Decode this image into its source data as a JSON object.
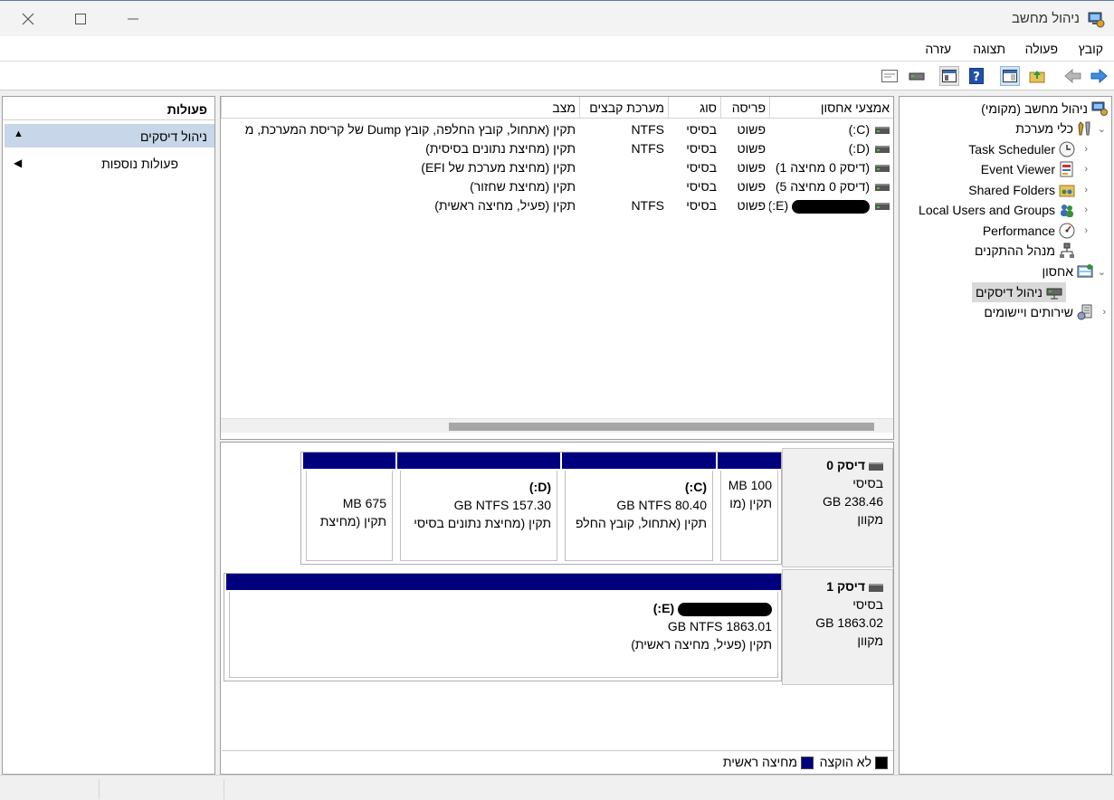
{
  "window": {
    "title": "ניהול מחשב"
  },
  "menu": [
    "קובץ",
    "פעולה",
    "תצוגה",
    "עזרה"
  ],
  "toolbar": [
    "back-arrow-icon",
    "forward-arrow-icon",
    "up-folder-icon",
    "show-hide-tree-icon",
    "help-icon",
    "properties-icon",
    "disk-icon",
    "console-icon"
  ],
  "tree": {
    "root": "ניהול מחשב (מקומי)",
    "system_tools": "כלי מערכת",
    "task_scheduler": "Task Scheduler",
    "event_viewer": "Event Viewer",
    "shared_folders": "Shared Folders",
    "local_users": "Local Users and Groups",
    "performance": "Performance",
    "device_manager": "מנהל ההתקנים",
    "storage": "אחסון",
    "disk_management": "ניהול דיסקים",
    "services": "שירותים ויישומים"
  },
  "actions": {
    "header": "פעולות",
    "section": "ניהול דיסקים",
    "more": "פעולות נוספות"
  },
  "volume_list": {
    "columns": [
      "אמצעי אחסון",
      "פריסה",
      "סוג",
      "מערכת קבצים",
      "מצב"
    ],
    "rows": [
      {
        "volume": "(C:)",
        "layout": "פשוט",
        "type": "בסיסי",
        "fs": "NTFS",
        "status": "תקין (אתחול, קובץ החלפה, קובץ Dump של קריסת המערכת, מ"
      },
      {
        "volume": "(D:)",
        "layout": "פשוט",
        "type": "בסיסי",
        "fs": "NTFS",
        "status": "תקין (מחיצת נתונים בסיסית)"
      },
      {
        "volume": "(דיסק 0 מחיצה 1)",
        "layout": "פשוט",
        "type": "בסיסי",
        "fs": "",
        "status": "תקין (מחיצת מערכת של EFI)"
      },
      {
        "volume": "(דיסק 0 מחיצה 5)",
        "layout": "פשוט",
        "type": "בסיסי",
        "fs": "",
        "status": "תקין (מחיצת שחזור)"
      },
      {
        "volume": "(E:)",
        "layout": "פשוט",
        "type": "בסיסי",
        "fs": "NTFS",
        "status": "תקין (פעיל, מחיצה ראשית)"
      }
    ]
  },
  "disks": {
    "disk0": {
      "name": "דיסק 0",
      "type": "בסיסי",
      "size": "238.46 GB",
      "state": "מקוון",
      "partitions": [
        {
          "name": "",
          "size": "100 MB",
          "status": "תקין (מו"
        },
        {
          "name": "(C:)",
          "size": "80.40 GB NTFS",
          "status": "תקין (אתחול, קובץ החלפ"
        },
        {
          "name": "(D:)",
          "size": "157.30 GB NTFS",
          "status": "תקין (מחיצת נתונים בסיסי"
        },
        {
          "name": "",
          "size": "675 MB",
          "status": "תקין (מחיצת"
        }
      ]
    },
    "disk1": {
      "name": "דיסק 1",
      "type": "בסיסי",
      "size": "1863.02 GB",
      "state": "מקוון",
      "partition": {
        "name": "(E:)",
        "size": "1863.01 GB NTFS",
        "status": "תקין (פעיל, מחיצה ראשית)"
      }
    }
  },
  "legend": {
    "unallocated": "לא הוקצה",
    "primary": "מחיצה ראשית"
  },
  "colors": {
    "primary_partition": "#00007f",
    "unallocated": "#000000",
    "selected_action": "#c7d6e8"
  }
}
